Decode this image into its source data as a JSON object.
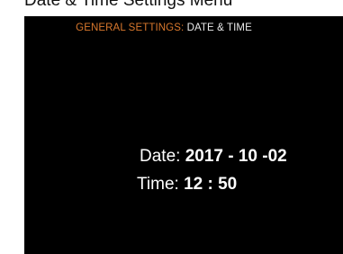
{
  "page_title": "Date & Time Settings Menu",
  "header": {
    "section": "GENERAL SETTINGS:",
    "page": "DATE & TIME"
  },
  "date": {
    "label": "Date:",
    "value": "2017 - 10 -02"
  },
  "time": {
    "label": "Time:",
    "value": "12 : 50"
  },
  "colors": {
    "screen_background": "#000000",
    "header_accent": "#d9782d",
    "text": "#ffffff"
  }
}
